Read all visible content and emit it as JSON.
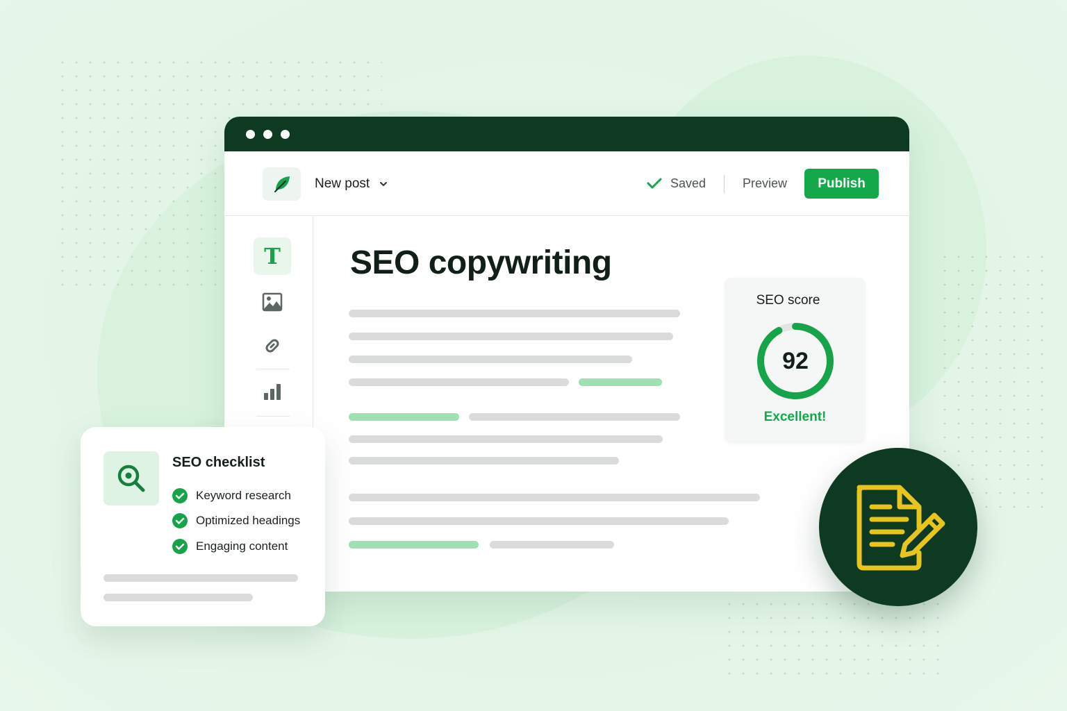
{
  "window": {
    "dots": [
      "dot",
      "dot",
      "dot"
    ]
  },
  "topbar": {
    "doc_title": "New post",
    "saved_label": "Saved",
    "preview_label": "Preview",
    "publish_label": "Publish",
    "logo_icon": "leaf-icon",
    "colors": {
      "titlebar": "#0d3a20",
      "publish": "#13a84a"
    }
  },
  "sidebar": {
    "tools": [
      {
        "name": "text-tool",
        "icon": "text-T-icon",
        "active": true
      },
      {
        "name": "image-tool",
        "icon": "image-icon",
        "active": false
      },
      {
        "name": "link-tool",
        "icon": "link-icon",
        "active": false
      },
      {
        "name": "chart-tool",
        "icon": "bar-chart-icon",
        "active": false
      }
    ]
  },
  "content": {
    "title": "SEO copywriting"
  },
  "seo_score": {
    "title": "SEO score",
    "value": "92",
    "progress": 0.92,
    "label": "Excellent!"
  },
  "checklist": {
    "title": "SEO checklist",
    "icon": "search-icon",
    "items": [
      "Keyword research",
      "Optimized headings",
      "Engaging content"
    ]
  },
  "badge": {
    "icon": "document-edit-icon",
    "accent": "#e8c51e"
  }
}
